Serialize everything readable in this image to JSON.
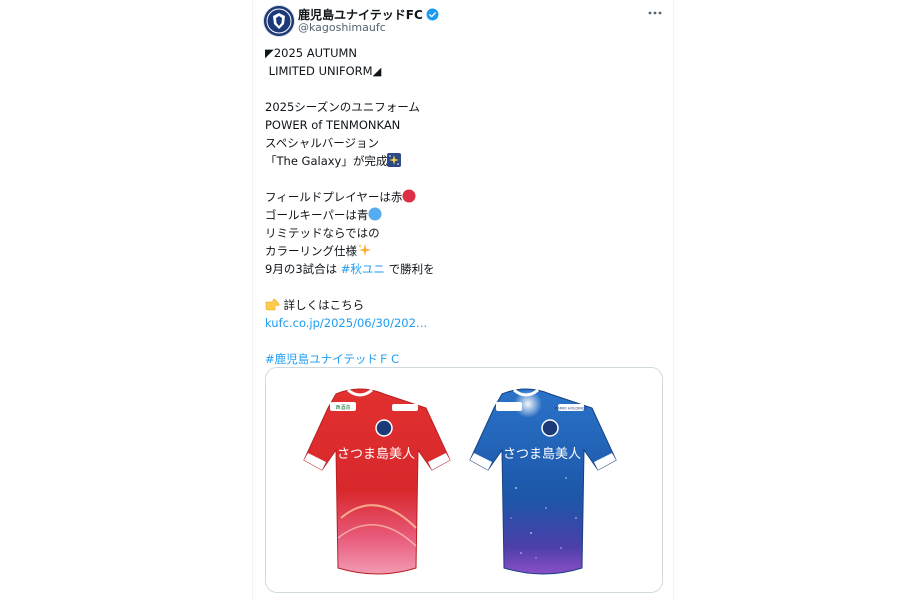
{
  "account": {
    "display_name": "鹿児島ユナイテッドFC",
    "handle": "@kagoshimaufc",
    "avatar_text": "KAGOSHIMA UNITED"
  },
  "tweet": {
    "lines": [
      "◤2025 AUTUMN",
      " LIMITED UNIFORM◢",
      "",
      "2025シーズンのユニフォーム",
      "POWER of TENMONKAN",
      "スペシャルバージョン",
      "「The Galaxy」が完成",
      "",
      "フィールドプレイヤーは赤",
      "ゴールキーパーは青",
      "リミテッドならではの",
      "カラーリング仕様"
    ],
    "line_match_prefix": "9月の3試合は ",
    "hashtag_autumn": "#秋ユニ",
    "line_match_suffix": " で勝利を",
    "details_label": "詳しくはこちら",
    "link_text": "kufc.co.jp/2025/06/30/202…",
    "hashtag_club": "#鹿児島ユナイテッドＦＣ"
  },
  "media": {
    "shirt_left_text": "さつま島美人",
    "shirt_right_text": "さつま島美人",
    "sponsor_left": "西酒造",
    "sponsor_right": "KAMIO HOLDINGS"
  },
  "colors": {
    "link": "#1d9bf0",
    "verified": "#1d9bf0",
    "red_shirt": "#d8282c",
    "blue_shirt": "#1e5fb4"
  },
  "icons": [
    "verified-badge-icon",
    "more-options-icon",
    "sparkle-fireworks-emoji",
    "red-circle-emoji",
    "blue-circle-emoji",
    "sparkles-emoji",
    "pointing-right-emoji"
  ]
}
